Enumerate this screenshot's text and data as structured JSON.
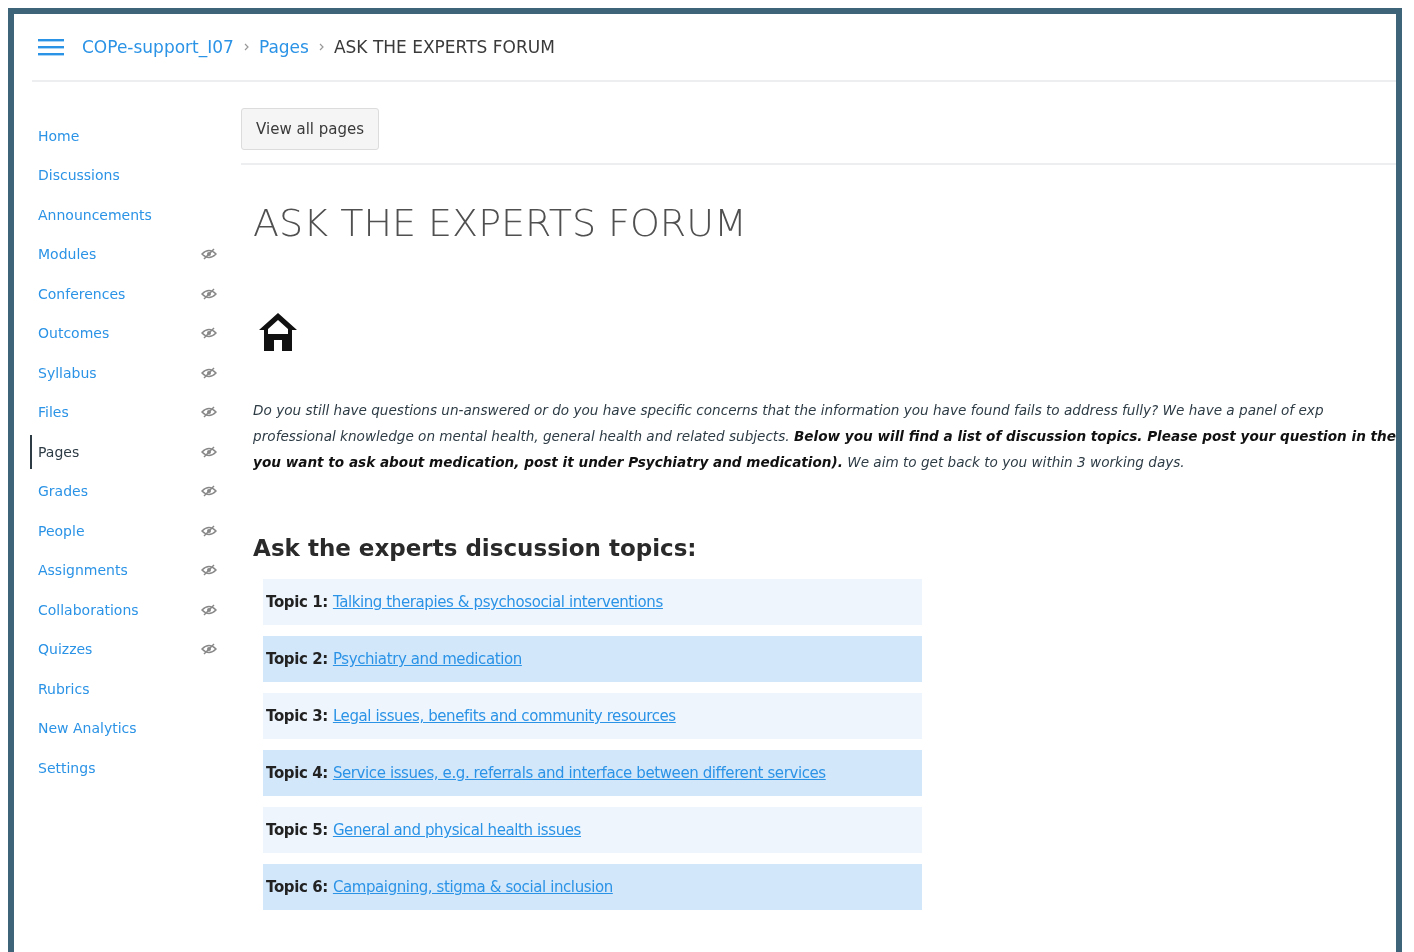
{
  "breadcrumb": [
    {
      "label": "COPe-support_I07",
      "link": true
    },
    {
      "label": "Pages",
      "link": true
    },
    {
      "label": "ASK THE EXPERTS FORUM",
      "link": false
    }
  ],
  "sidebar": {
    "items": [
      {
        "label": "Home",
        "selected": false,
        "hidden": false
      },
      {
        "label": "Discussions",
        "selected": false,
        "hidden": false
      },
      {
        "label": "Announcements",
        "selected": false,
        "hidden": false
      },
      {
        "label": "Modules",
        "selected": false,
        "hidden": true
      },
      {
        "label": "Conferences",
        "selected": false,
        "hidden": true
      },
      {
        "label": "Outcomes",
        "selected": false,
        "hidden": true
      },
      {
        "label": "Syllabus",
        "selected": false,
        "hidden": true
      },
      {
        "label": "Files",
        "selected": false,
        "hidden": true
      },
      {
        "label": "Pages",
        "selected": true,
        "hidden": true
      },
      {
        "label": "Grades",
        "selected": false,
        "hidden": true
      },
      {
        "label": "People",
        "selected": false,
        "hidden": true
      },
      {
        "label": "Assignments",
        "selected": false,
        "hidden": true
      },
      {
        "label": "Collaborations",
        "selected": false,
        "hidden": true
      },
      {
        "label": "Quizzes",
        "selected": false,
        "hidden": true
      },
      {
        "label": "Rubrics",
        "selected": false,
        "hidden": false
      },
      {
        "label": "New Analytics",
        "selected": false,
        "hidden": false
      },
      {
        "label": "Settings",
        "selected": false,
        "hidden": false
      }
    ]
  },
  "view_all_button": "View all pages",
  "page_title": "ASK THE EXPERTS FORUM",
  "intro_lines": [
    "Do you still have questions un-answered or do you have specific concerns that the information you have found fails to address fully? We have a panel of exp",
    "professional knowledge on mental health, general health and related subjects. **Below you will find a list of discussion topics. Please post your question in the**",
    "**you want to ask about medication, post it under Psychiatry and medication).** We aim to get back to you within 3 working days."
  ],
  "topics_heading": "Ask the experts discussion topics:",
  "topics": [
    {
      "label": "Topic 1:",
      "link": "Talking therapies & psychosocial interventions",
      "color": "#eef5fd"
    },
    {
      "label": "Topic 2:",
      "link": "Psychiatry and medication",
      "color": "#d3e7fb"
    },
    {
      "label": "Topic 3:",
      "link": "Legal issues, benefits and community resources",
      "color": "#eef5fd"
    },
    {
      "label": "Topic 4:",
      "link": "Service issues, e.g. referrals and interface between different services",
      "color": "#d3e7fb"
    },
    {
      "label": "Topic 5:",
      "link": "General and physical health issues",
      "color": "#eef5fd"
    },
    {
      "label": "Topic 6:",
      "link": "Campaigning, stigma & social inclusion",
      "color": "#d3e7fb"
    }
  ]
}
